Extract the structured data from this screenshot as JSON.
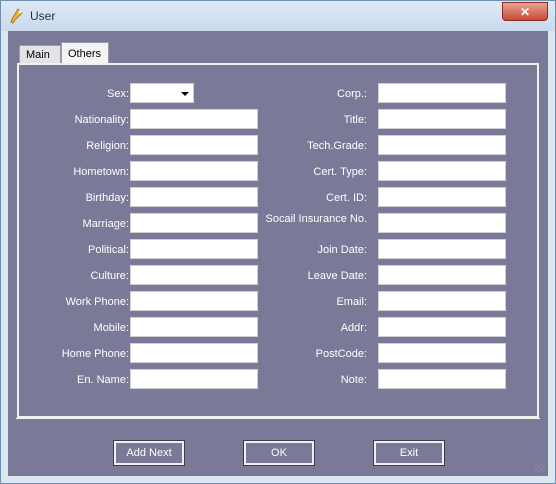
{
  "window": {
    "title": "User",
    "close_label": "✕"
  },
  "tabs": [
    {
      "label": "Main"
    },
    {
      "label": "Others"
    }
  ],
  "form": {
    "left": [
      {
        "label": "Sex:"
      },
      {
        "label": "Nationality:"
      },
      {
        "label": "Religion:"
      },
      {
        "label": "Hometown:"
      },
      {
        "label": "Birthday:"
      },
      {
        "label": "Marriage:"
      },
      {
        "label": "Political:"
      },
      {
        "label": "Culture:"
      },
      {
        "label": "Work Phone:"
      },
      {
        "label": "Mobile:"
      },
      {
        "label": "Home Phone:"
      },
      {
        "label": "En. Name:"
      }
    ],
    "right": [
      {
        "label": "Corp.:"
      },
      {
        "label": "Title:"
      },
      {
        "label": "Tech.Grade:"
      },
      {
        "label": "Cert. Type:"
      },
      {
        "label": "Cert. ID:"
      },
      {
        "label": "Socail Insurance No."
      },
      {
        "label": "Join Date:"
      },
      {
        "label": "Leave Date:"
      },
      {
        "label": "Email:"
      },
      {
        "label": "Addr:"
      },
      {
        "label": "PostCode:"
      },
      {
        "label": "Note:"
      }
    ]
  },
  "buttons": {
    "add_next": "Add Next",
    "ok": "OK",
    "exit": "Exit"
  }
}
